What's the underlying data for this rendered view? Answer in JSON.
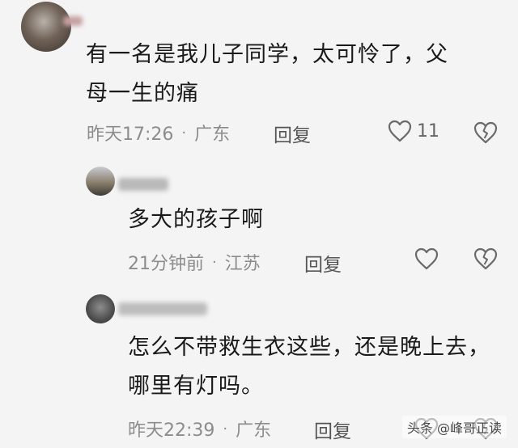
{
  "comments": [
    {
      "text_lines": [
        "有一名是我儿子同学，太可怜了，父",
        "母一生的痛"
      ],
      "time": "昨天17:26",
      "location": "广东",
      "reply_label": "回复",
      "like_count": "11",
      "like_icon": "heart-outline-icon",
      "dislike_icon": "broken-heart-icon"
    },
    {
      "text_lines": [
        "多大的孩子啊"
      ],
      "time": "21分钟前",
      "location": "江苏",
      "reply_label": "回复",
      "like_count": "",
      "like_icon": "heart-outline-icon",
      "dislike_icon": "broken-heart-icon"
    },
    {
      "text_lines": [
        "怎么不带救生衣这些，还是晚上去，",
        "哪里有灯吗。"
      ],
      "time": "昨天22:39",
      "location": "广东",
      "reply_label": "回复",
      "like_count": "",
      "like_icon": "heart-outline-icon",
      "dislike_icon": "broken-heart-icon"
    }
  ],
  "meta_separator": "·",
  "watermark": "头条 @峰哥正读",
  "colors": {
    "background": "#f4f4f4",
    "text": "#1a1a1a",
    "meta": "#8c8c8c",
    "icon": "#6a6a6a"
  }
}
